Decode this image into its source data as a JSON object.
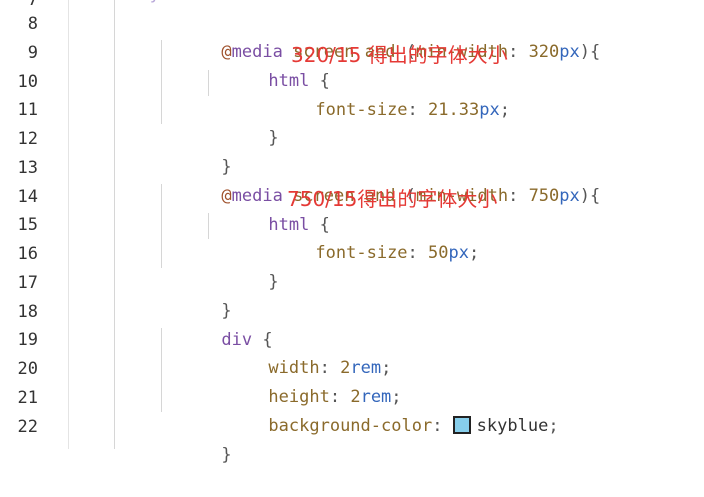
{
  "colors": {
    "swatch": "#87CEEB",
    "annotation": "#e53935"
  },
  "line_numbers": [
    "7",
    "8",
    "9",
    "10",
    "11",
    "12",
    "13",
    "14",
    "15",
    "16",
    "17",
    "18",
    "19",
    "20",
    "21",
    "22"
  ],
  "partial_top_text": "<style>",
  "lines": {
    "l8": {
      "at": "@",
      "media": "media",
      "rest1": " screen ",
      "and": "and",
      "rest2": " (",
      "prop": "min-width",
      "colon": ": ",
      "num": "320",
      "unit": "px",
      "close": "){"
    },
    "l9": {
      "sel": "html",
      "brace": " {"
    },
    "l10": {
      "prop": "font-size",
      "colon": ": ",
      "num": "21.33",
      "unit": "px",
      "semi": ";"
    },
    "l11": {
      "brace": "}"
    },
    "l12": {
      "brace": "}"
    },
    "l13": {
      "at": "@",
      "media": "media",
      "rest1": " screen ",
      "and": "and",
      "rest2": " (",
      "prop": "min-width",
      "colon": ": ",
      "num": "750",
      "unit": "px",
      "close": "){"
    },
    "l14": {
      "sel": "html",
      "brace": " {"
    },
    "l15": {
      "prop": "font-size",
      "colon": ": ",
      "num": "50",
      "unit": "px",
      "semi": ";"
    },
    "l16": {
      "brace": "}"
    },
    "l17": {
      "brace": "}"
    },
    "l18": {
      "sel": "div",
      "brace": " {"
    },
    "l19": {
      "prop": "width",
      "colon": ": ",
      "num": "2",
      "unit": "rem",
      "semi": ";"
    },
    "l20": {
      "prop": "height",
      "colon": ": ",
      "num": "2",
      "unit": "rem",
      "semi": ";"
    },
    "l21": {
      "prop": "background-color",
      "colon": ": ",
      "val": "skyblue",
      "semi": ";"
    },
    "l22": {
      "brace": "}"
    }
  },
  "annotations": {
    "a1": "320/15 得出的字体大小",
    "a2": "750/15得出的字体大小"
  }
}
